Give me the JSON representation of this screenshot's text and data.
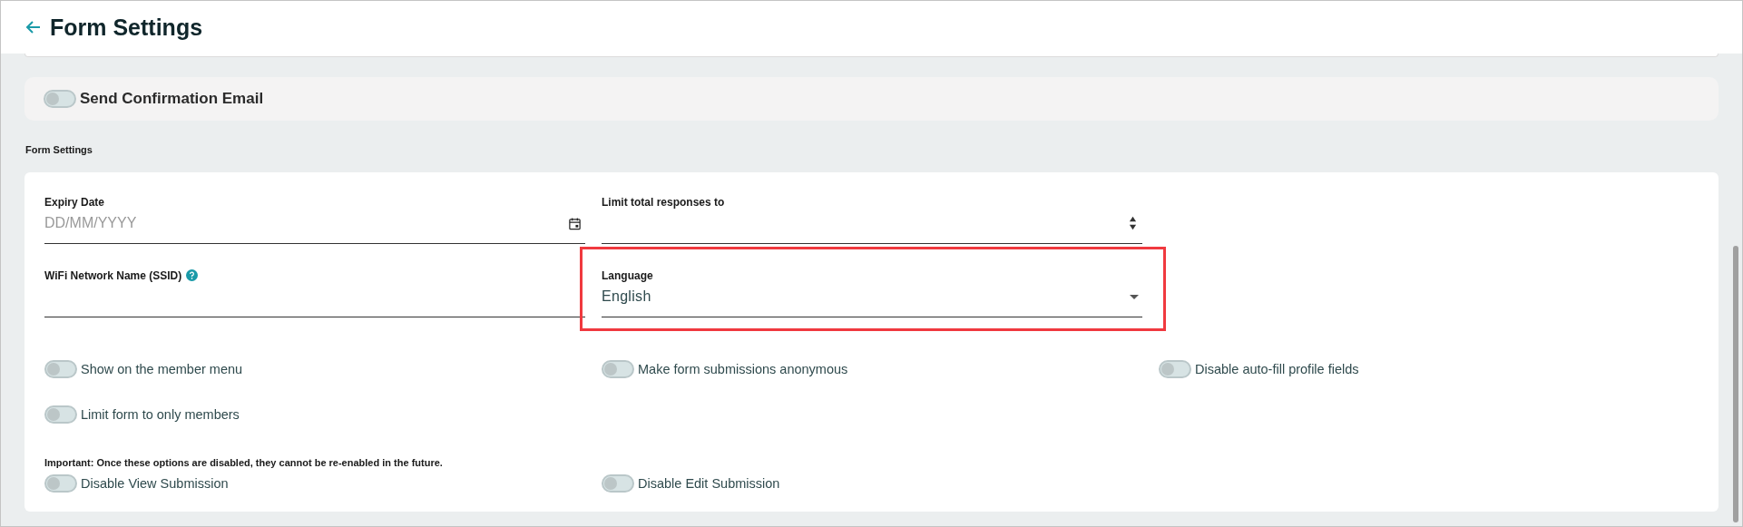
{
  "header": {
    "title": "Form Settings"
  },
  "confirmation": {
    "label": "Send Confirmation Email",
    "on": false
  },
  "section_label": "Form Settings",
  "fields": [
    {
      "kind": "date",
      "label": "Expiry Date",
      "placeholder": "DD/MM/YYYY",
      "highlighted": false
    },
    {
      "kind": "number",
      "label": "Limit total responses to",
      "highlighted": false
    },
    {
      "kind": "text",
      "label": "WiFi Network Name (SSID)",
      "help": true,
      "highlighted": false
    },
    {
      "kind": "select",
      "label": "Language",
      "value": "English",
      "highlighted": true
    }
  ],
  "toggles": [
    {
      "label": "Show on the member menu",
      "on": false
    },
    {
      "label": "Make form submissions anonymous",
      "on": false
    },
    {
      "label": "Disable auto-fill profile fields",
      "on": false
    },
    {
      "label": "Limit form to only members",
      "on": false
    }
  ],
  "important_note": "Important: Once these options are disabled, they cannot be re-enabled in the future.",
  "locked_toggles": [
    {
      "label": "Disable View Submission",
      "on": false
    },
    {
      "label": "Disable Edit Submission",
      "on": false
    }
  ]
}
